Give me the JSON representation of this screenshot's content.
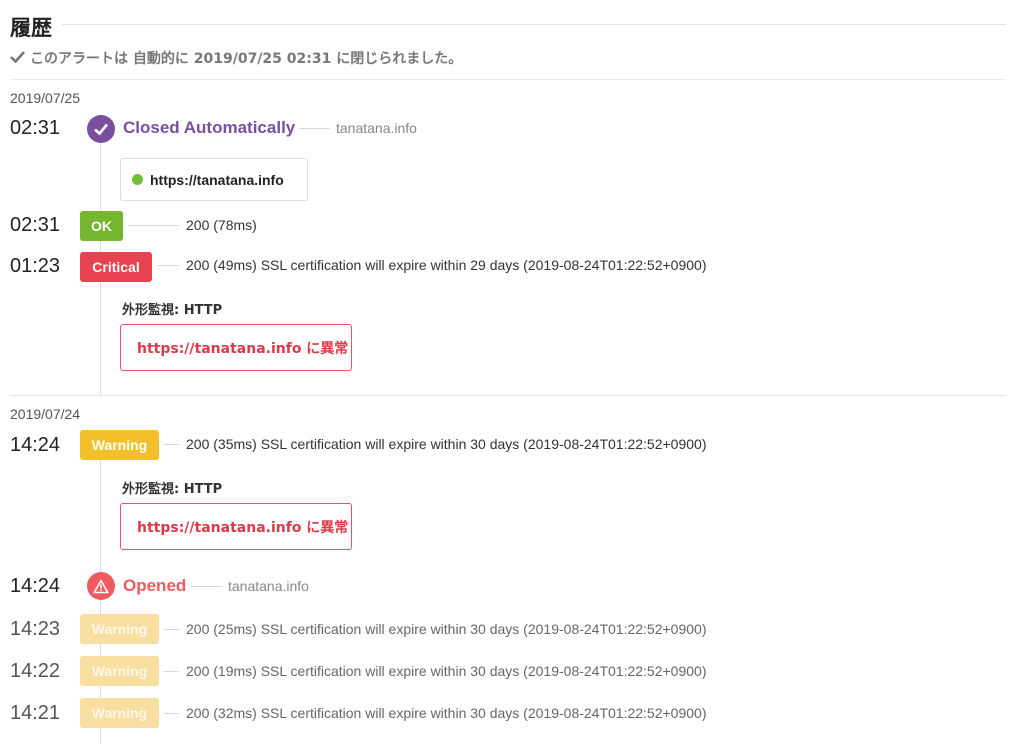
{
  "header": {
    "title": "履歴",
    "closed_note": "このアラートは 自動的に 2019/07/25 02:31 に閉じられました。"
  },
  "days": [
    {
      "date": "2019/07/25",
      "events": [
        {
          "time": "02:31",
          "kind": "status",
          "title": "Closed Automatically",
          "host": "tanatana.info",
          "url": "https://tanatana.info",
          "url_status_color": "#6cc03a"
        },
        {
          "time": "02:31",
          "kind": "check",
          "badge": "OK",
          "message": "200 (78ms)"
        },
        {
          "time": "01:23",
          "kind": "check",
          "badge": "Critical",
          "message": "200 (49ms) SSL certification will expire within 29 days (2019-08-24T01:22:52+0900)",
          "monitor_label": "外形監視: HTTP",
          "alert_link": "https://tanatana.info に異常"
        }
      ]
    },
    {
      "date": "2019/07/24",
      "events": [
        {
          "time": "14:24",
          "kind": "check",
          "badge": "Warning",
          "message": "200 (35ms) SSL certification will expire within 30 days (2019-08-24T01:22:52+0900)",
          "monitor_label": "外形監視: HTTP",
          "alert_link": "https://tanatana.info に異常"
        },
        {
          "time": "14:24",
          "kind": "status",
          "title": "Opened",
          "host": "tanatana.info"
        },
        {
          "time": "14:23",
          "kind": "check",
          "badge": "Warning",
          "message": "200 (25ms) SSL certification will expire within 30 days (2019-08-24T01:22:52+0900)"
        },
        {
          "time": "14:22",
          "kind": "check",
          "badge": "Warning",
          "message": "200 (19ms) SSL certification will expire within 30 days (2019-08-24T01:22:52+0900)"
        },
        {
          "time": "14:21",
          "kind": "check",
          "badge": "Warning",
          "message": "200 (32ms) SSL certification will expire within 30 days (2019-08-24T01:22:52+0900)"
        }
      ]
    }
  ],
  "colors": {
    "closed": "#7b4f9d",
    "opened": "#ef5a5f",
    "ok": "#74b72e",
    "critical": "#e8414f",
    "warning": "#f3c02b"
  },
  "icons": {
    "closed_note": "checkmark-icon",
    "closed": "check-circle-icon",
    "opened": "warning-triangle-icon"
  }
}
